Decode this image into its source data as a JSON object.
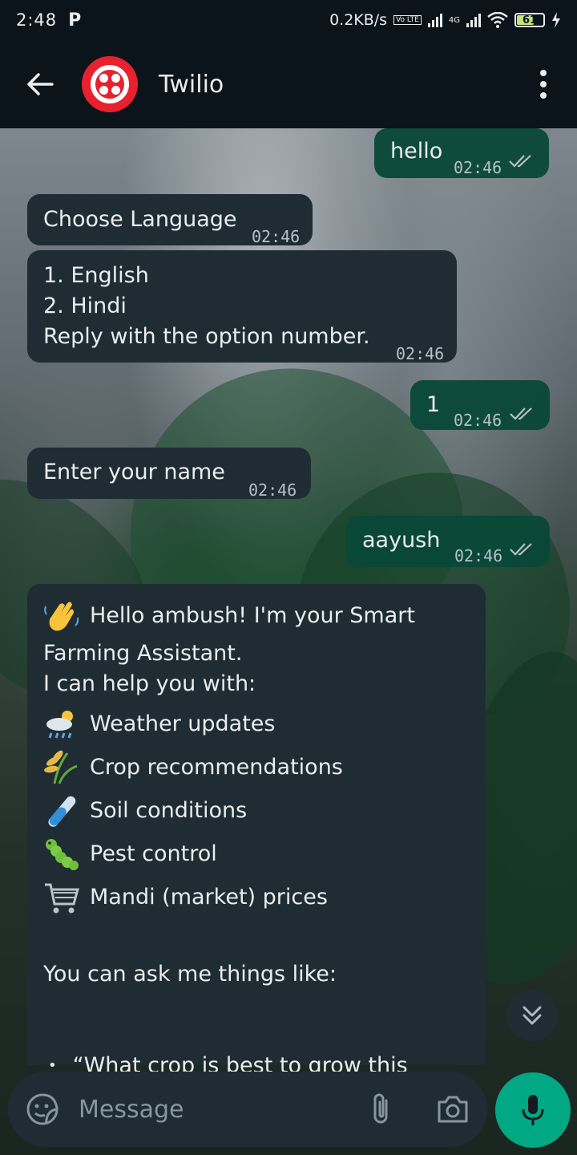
{
  "status_bar": {
    "time": "2:48",
    "app_icon": "P",
    "speed": "0.2KB/s",
    "volte": "Vo LTE",
    "net": "4G",
    "battery": "61"
  },
  "header": {
    "contact_name": "Twilio"
  },
  "messages": [
    {
      "text": "hello",
      "time": "02:46",
      "direction": "out"
    },
    {
      "text": "Choose Language",
      "time": "02:46",
      "direction": "in"
    },
    {
      "lines": [
        "1. English",
        "2. Hindi",
        "Reply with the option number."
      ],
      "time": "02:46",
      "direction": "in"
    },
    {
      "text": "1",
      "time": "02:46",
      "direction": "out"
    },
    {
      "text": "Enter your name",
      "time": "02:46",
      "direction": "in"
    },
    {
      "text": "aayush",
      "time": "02:46",
      "direction": "out"
    }
  ],
  "welcome": {
    "greeting_line1": "Hello ambush! I'm your Smart",
    "greeting_line2": "Farming Assistant.",
    "intro": "I can help you with:",
    "features": [
      {
        "icon": "weather-icon",
        "label": "Weather updates"
      },
      {
        "icon": "crop-icon",
        "label": "Crop recommendations"
      },
      {
        "icon": "soil-icon",
        "label": "Soil conditions"
      },
      {
        "icon": "pest-icon",
        "label": "Pest control"
      },
      {
        "icon": "cart-icon",
        "label": "Mandi (market) prices"
      }
    ],
    "ask": "You can ask me things like:",
    "example": "“What crop is best to grow this"
  },
  "input": {
    "placeholder": "Message"
  },
  "colors": {
    "incoming": "#202c33",
    "outgoing": "#084838",
    "accent": "#00a884",
    "avatar": "#e8212e"
  }
}
